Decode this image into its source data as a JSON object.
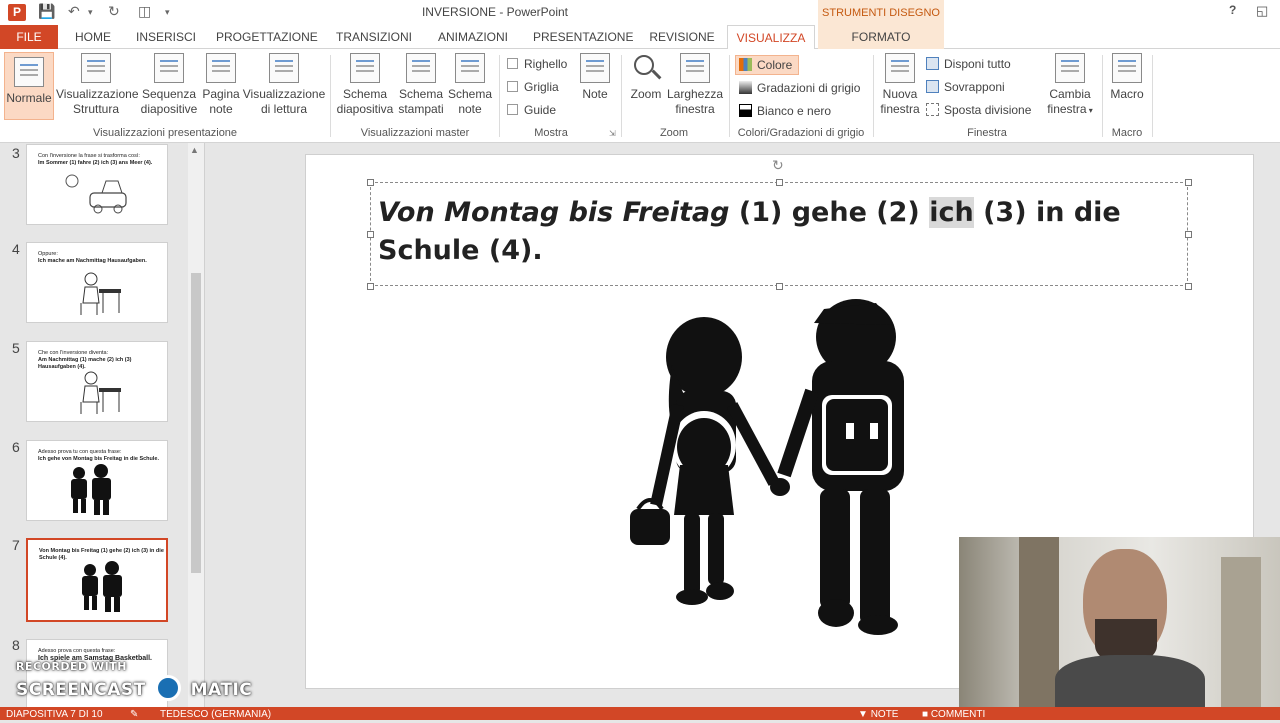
{
  "titlebar": {
    "app_icon": "P",
    "title": "INVERSIONE - PowerPoint",
    "context_title": "STRUMENTI DISEGNO",
    "help": "?"
  },
  "tabs": [
    "FILE",
    "HOME",
    "INSERISCI",
    "PROGETTAZIONE",
    "TRANSIZIONI",
    "ANIMAZIONI",
    "PRESENTAZIONE",
    "REVISIONE",
    "VISUALIZZA",
    "FORMATO"
  ],
  "active_tab": "VISUALIZZA",
  "ribbon": {
    "presentation_views": {
      "label": "Visualizzazioni presentazione",
      "normale": "Normale",
      "struttura": [
        "Visualizzazione",
        "Struttura"
      ],
      "sequenza": [
        "Sequenza",
        "diapositive"
      ],
      "pagina_note": [
        "Pagina",
        "note"
      ],
      "lettura": [
        "Visualizzazione",
        "di lettura"
      ]
    },
    "master_views": {
      "label": "Visualizzazioni master",
      "schema_diapositiva": [
        "Schema",
        "diapositiva"
      ],
      "schema_stampati": [
        "Schema",
        "stampati"
      ],
      "schema_note": [
        "Schema",
        "note"
      ]
    },
    "mostra": {
      "label": "Mostra",
      "righello": "Righello",
      "griglia": "Griglia",
      "guide": "Guide",
      "note": "Note"
    },
    "zoom": {
      "label": "Zoom",
      "zoom": "Zoom",
      "larghezza": [
        "Larghezza",
        "finestra"
      ]
    },
    "color": {
      "label": "Colori/Gradazioni di grigio",
      "colore": "Colore",
      "grigio": "Gradazioni di grigio",
      "bianco_nero": "Bianco e nero"
    },
    "finestra": {
      "label": "Finestra",
      "nuova": [
        "Nuova",
        "finestra"
      ],
      "disponi": "Disponi tutto",
      "sovrapponi": "Sovrapponi",
      "sposta": "Sposta divisione",
      "cambia": [
        "Cambia",
        "finestra"
      ]
    },
    "macro": {
      "label": "Macro",
      "macro": "Macro"
    }
  },
  "thumbnails": [
    {
      "num": "3",
      "text": [
        "Con l'inversione la frase si trasforma così:",
        "Im Sommer (1) fahre (2) ich (3) ans Meer (4)."
      ]
    },
    {
      "num": "4",
      "text": [
        "Oppure:",
        "Ich mache am Nachmittag Hausaufgaben."
      ]
    },
    {
      "num": "5",
      "text": [
        "Che con l'inversione diventa:",
        "Am Nachmittag (1) mache (2) ich (3) Hausaufgaben (4)."
      ]
    },
    {
      "num": "6",
      "text": [
        "Adesso prova tu con questa frase:",
        "Ich gehe von Montag bis Freitag in die Schule."
      ]
    },
    {
      "num": "7",
      "text": [
        "",
        "Von Montag bis Freitag (1) gehe (2) ich (3) in die Schule (4)."
      ]
    },
    {
      "num": "8",
      "text": [
        "Adesso prova con questa frase:",
        "Ich spiele am Samstag Basketball."
      ]
    }
  ],
  "slide": {
    "seg1": "Von Montag bis Freitag",
    "seg2": " (1) gehe (2) ",
    "seg3": "ich",
    "seg4": " (3) in die Schule (4)."
  },
  "status": {
    "slide": "DIAPOSITIVA 7 DI 10",
    "language": "TEDESCO (GERMANIA)",
    "notes": "NOTE",
    "comments": "COMMENTI"
  },
  "watermark": {
    "line1": "RECORDED WITH",
    "line2a": "SCREENCAST",
    "line2b": "MATIC"
  },
  "colors": {
    "accent": "#d24726",
    "context": "#fbe7d4"
  }
}
